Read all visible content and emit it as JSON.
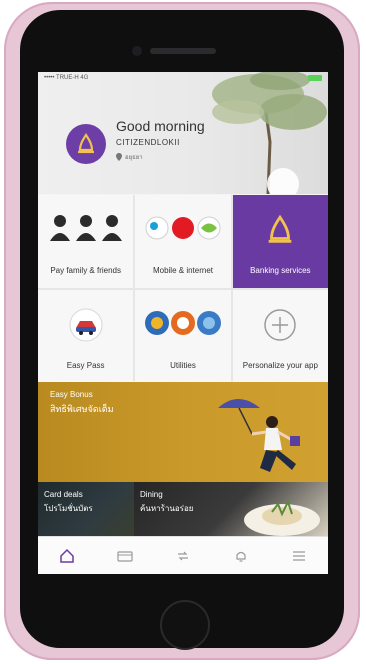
{
  "status_bar": {
    "carrier": "••••• TRUE-H  4G"
  },
  "header": {
    "greeting": "Good morning",
    "username": "CITIZENDLOKII",
    "location": "อยุธยา"
  },
  "tiles": [
    {
      "label": "Pay family & friends",
      "icon": "people-icon"
    },
    {
      "label": "Mobile & internet",
      "icon": "carrier-logos-icon"
    },
    {
      "label": "Banking services",
      "icon": "bank-bell-icon",
      "highlighted": true
    },
    {
      "label": "Easy Pass",
      "icon": "car-icon"
    },
    {
      "label": "Utilities",
      "icon": "utility-logos-icon"
    },
    {
      "label": "Personalize your app",
      "icon": "plus-icon"
    }
  ],
  "banner": {
    "title": "Easy Bonus",
    "subtitle": "สิทธิพิเศษจัดเต็ม"
  },
  "deals": [
    {
      "title": "Card deals",
      "subtitle": "โปรโมชั่นบัตร"
    },
    {
      "title": "Dining",
      "subtitle": "ค้นหาร้านอร่อย"
    }
  ],
  "tabbar": [
    "home-icon",
    "card-icon",
    "transfer-icon",
    "bell-icon",
    "menu-icon"
  ],
  "colors": {
    "brand_purple": "#6a3aa3",
    "banner_gold": "#c9992a",
    "case_pink": "#e7c6d6"
  }
}
